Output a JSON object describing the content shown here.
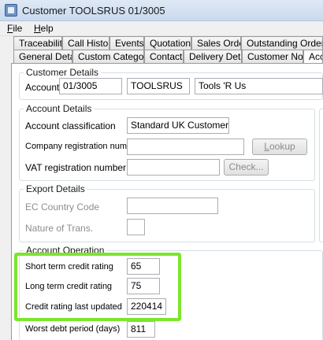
{
  "window": {
    "title": "Customer TOOLSRUS 01/3005"
  },
  "menu": {
    "file_u": "F",
    "file_rest": "ile",
    "help_u": "H",
    "help_rest": "elp"
  },
  "tabs_row1": [
    "Traceability",
    "Call History",
    "Events",
    "Quotations",
    "Sales Orders",
    "Outstanding Order Items"
  ],
  "tabs_row2": [
    "General Details",
    "Custom Categories",
    "Contacts",
    "Delivery Details",
    "Customer Notes",
    "Account"
  ],
  "customer_details": {
    "title": "Customer Details",
    "account_label": "Account",
    "account_number": "01/3005",
    "account_code": "TOOLSRUS",
    "account_name": "Tools 'R Us"
  },
  "account_details": {
    "title": "Account Details",
    "classification_label": "Account classification",
    "classification_value": "Standard UK Customer",
    "company_reg_label": "Company registration number",
    "company_reg_value": "",
    "lookup_u": "L",
    "lookup_rest": "ookup",
    "vat_label": "VAT registration number",
    "vat_value": "",
    "check_label": "Check..."
  },
  "export_details": {
    "title": "Export Details",
    "ec_country_label": "EC Country Code",
    "ec_country_value": "",
    "nature_label": "Nature of Trans.",
    "nature_value": ""
  },
  "account_operation": {
    "title": "Account Operation",
    "short_term_label": "Short term credit rating",
    "short_term_value": "65",
    "long_term_label": "Long term credit rating",
    "long_term_value": "75",
    "rating_updated_label": "Credit rating last updated",
    "rating_updated_value": "220414",
    "worst_debt_label": "Worst debt period (days)",
    "worst_debt_value": "811"
  },
  "colors": {
    "highlight": "#7ce52c",
    "group_border": "#d5dfe5"
  }
}
